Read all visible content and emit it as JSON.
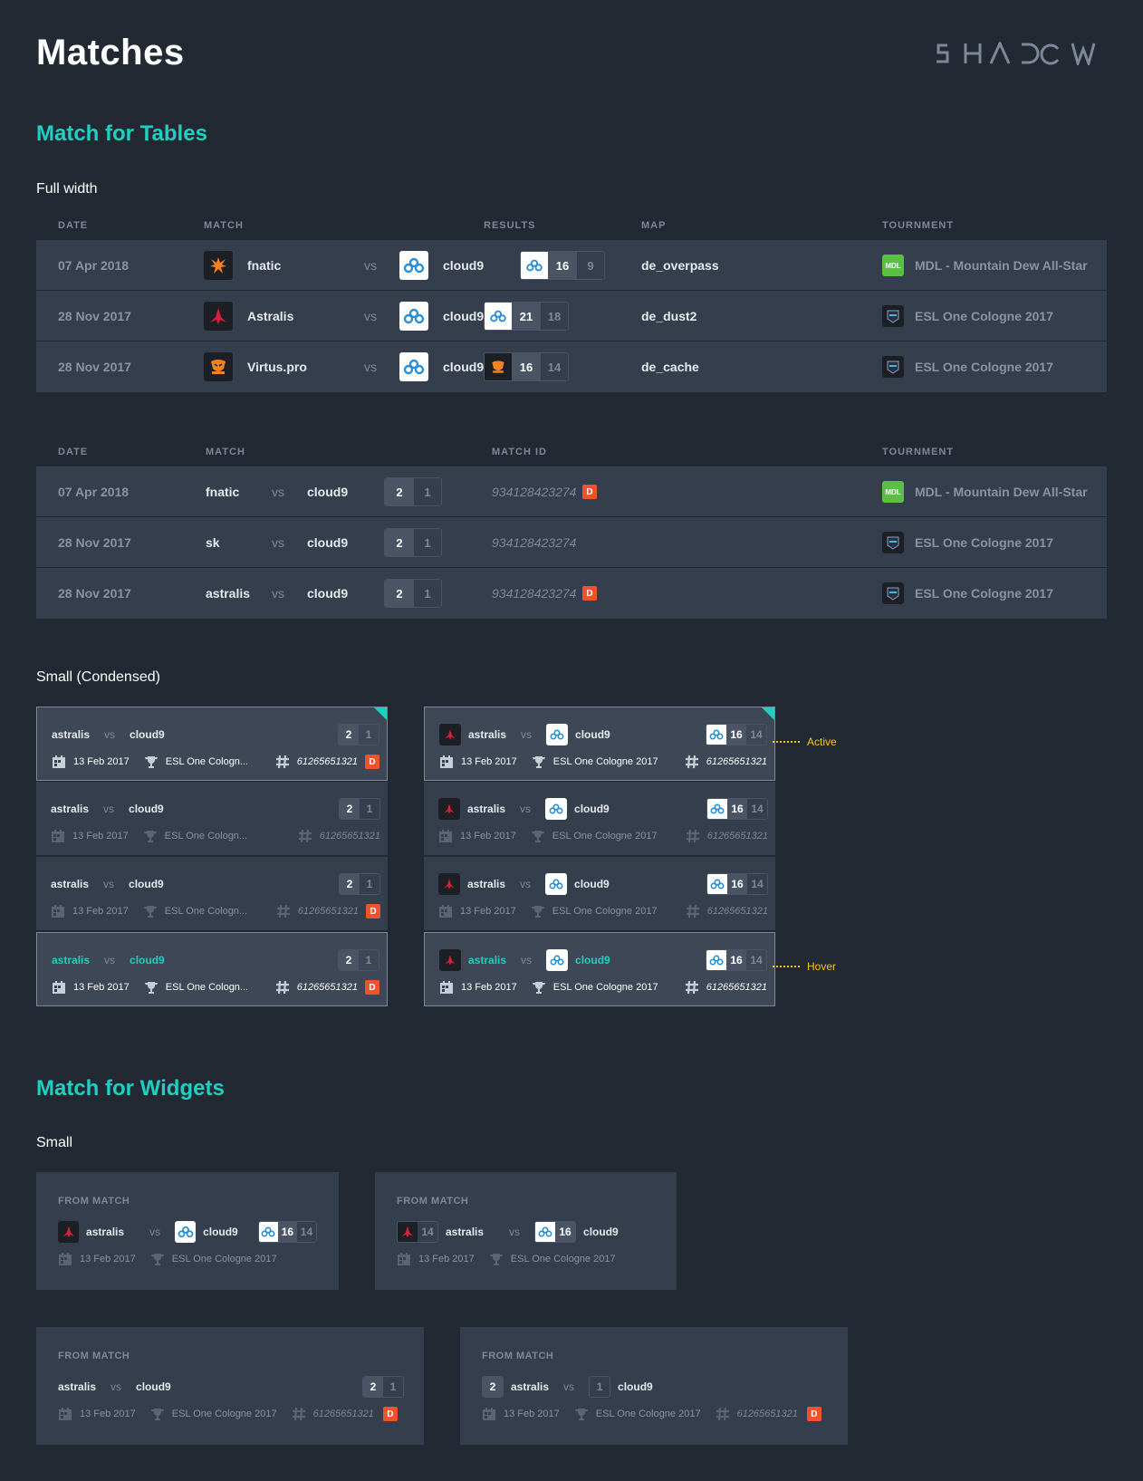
{
  "header": {
    "title": "Matches",
    "brand": "SHADOW"
  },
  "sections": {
    "tables": "Match for Tables",
    "full_width": "Full width",
    "small_condensed": "Small (Condensed)",
    "widgets": "Match for Widgets",
    "small": "Small"
  },
  "table1": {
    "headers": [
      "DATE",
      "MATCH",
      "RESULTS",
      "MAP",
      "TOURNMENT"
    ],
    "rows": [
      {
        "date": "07 Apr 2018",
        "team1": "fnatic",
        "vs": "vs",
        "team2": "cloud9",
        "win": "16",
        "loss": "9",
        "map": "de_overpass",
        "tournament": "MDL - Mountain Dew All-Star"
      },
      {
        "date": "28 Nov 2017",
        "team1": "Astralis",
        "vs": "vs",
        "team2": "cloud9",
        "win": "21",
        "loss": "18",
        "map": "de_dust2",
        "tournament": "ESL One Cologne 2017"
      },
      {
        "date": "28 Nov 2017",
        "team1": "Virtus.pro",
        "vs": "vs",
        "team2": "cloud9",
        "win": "16",
        "loss": "14",
        "map": "de_cache",
        "tournament": "ESL One Cologne 2017"
      }
    ]
  },
  "table2": {
    "headers": [
      "DATE",
      "MATCH",
      "MATCH ID",
      "TOURNMENT"
    ],
    "rows": [
      {
        "date": "07 Apr 2018",
        "team1": "fnatic",
        "vs": "vs",
        "team2": "cloud9",
        "win": "2",
        "loss": "1",
        "match_id": "934128423274",
        "badge": "D",
        "tournament": "MDL - Mountain Dew All-Star"
      },
      {
        "date": "28 Nov 2017",
        "team1": "sk",
        "vs": "vs",
        "team2": "cloud9",
        "win": "2",
        "loss": "1",
        "match_id": "934128423274",
        "badge": "",
        "tournament": "ESL One Cologne 2017"
      },
      {
        "date": "28 Nov 2017",
        "team1": "astralis",
        "vs": "vs",
        "team2": "cloud9",
        "win": "2",
        "loss": "1",
        "match_id": "934128423274",
        "badge": "D",
        "tournament": "ESL One Cologne 2017"
      }
    ]
  },
  "condensed": {
    "team1": "astralis",
    "vs": "vs",
    "team2": "cloud9",
    "left_win": "2",
    "left_loss": "1",
    "right_win": "16",
    "right_loss": "14",
    "date": "13 Feb 2017",
    "tournament_short": "ESL One Cologn...",
    "tournament": "ESL One Cologne 2017",
    "match_id": "61265651321",
    "badge": "D",
    "active_label": "Active",
    "hover_label": "Hover"
  },
  "widgets": {
    "label": "FROM MATCH",
    "team1": "astralis",
    "vs": "vs",
    "team2": "cloud9",
    "win": "16",
    "loss": "14",
    "series_win": "2",
    "series_loss": "1",
    "date": "13 Feb 2017",
    "tournament": "ESL One Cologne 2017",
    "match_id": "61265651321",
    "badge": "D"
  }
}
